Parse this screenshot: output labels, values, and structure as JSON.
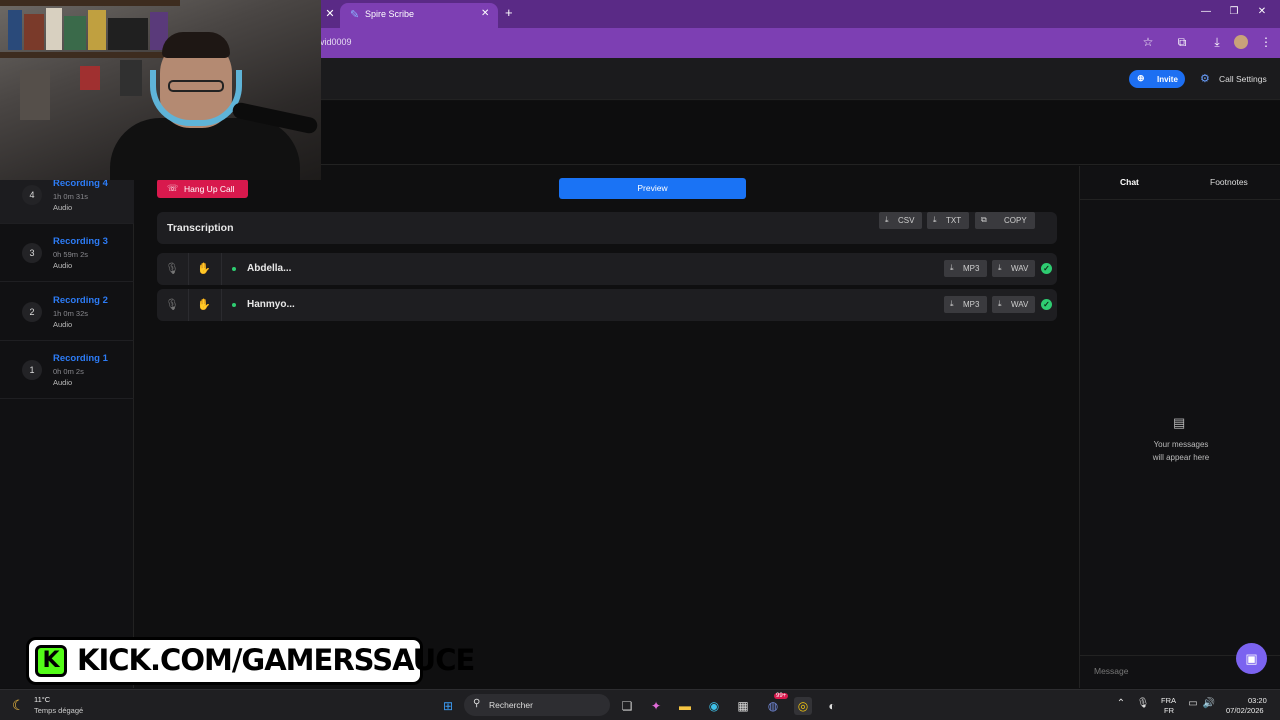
{
  "browser": {
    "tab_title": "Spire Scribe",
    "url_fragment": "vid0009"
  },
  "header": {
    "invite_label": "Invite",
    "call_settings_label": "Call Settings"
  },
  "sidebar": {
    "items": [
      {
        "num": "4",
        "title": "Recording 4",
        "duration": "1h 0m 31s",
        "type": "Audio"
      },
      {
        "num": "3",
        "title": "Recording 3",
        "duration": "0h 59m 2s",
        "type": "Audio"
      },
      {
        "num": "2",
        "title": "Recording 2",
        "duration": "1h 0m 32s",
        "type": "Audio"
      },
      {
        "num": "1",
        "title": "Recording 1",
        "duration": "0h 0m 2s",
        "type": "Audio"
      }
    ]
  },
  "main": {
    "hangup_label": "Hang Up Call",
    "preview_label": "Preview",
    "transcription": {
      "title": "Transcription",
      "csv_label": "CSV",
      "txt_label": "TXT",
      "copy_label": "COPY"
    },
    "participants": [
      {
        "name": "Abdella...",
        "mp3_label": "MP3",
        "wav_label": "WAV"
      },
      {
        "name": "Hanmyo...",
        "mp3_label": "MP3",
        "wav_label": "WAV"
      }
    ]
  },
  "chat": {
    "tab_chat": "Chat",
    "tab_footnotes": "Footnotes",
    "empty_line1": "Your messages",
    "empty_line2": "will appear here",
    "input_placeholder": "Message"
  },
  "overlay": {
    "kick_text": "KICK.COM/GAMERSSAUCE",
    "kick_logo_letter": "K"
  },
  "taskbar": {
    "temperature": "11°C",
    "weather": "Temps dégagé",
    "search_label": "Rechercher",
    "lang_top": "FRA",
    "lang_bottom": "FR",
    "time": "03:20",
    "date": "07/02/2026",
    "badge": "99+"
  },
  "colors": {
    "browser_frame": "#7d3fb3",
    "accent_blue": "#1a73f5",
    "hangup_red": "#d8194d",
    "status_green": "#2ecc71",
    "kick_green": "#53fc18"
  }
}
